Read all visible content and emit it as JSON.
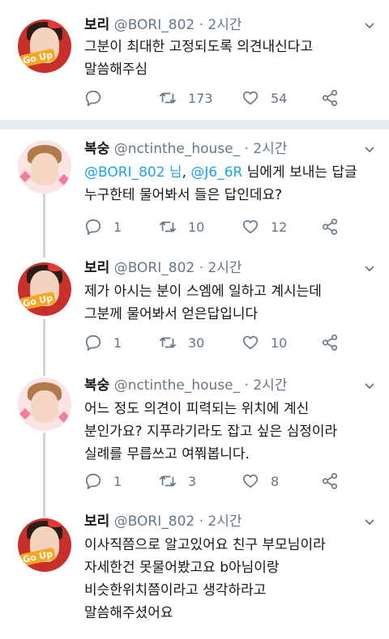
{
  "tweets": [
    {
      "name": "보리",
      "handle": "@BORI_802",
      "dot": "·",
      "time": "2시간",
      "lines": [
        "그분이 최대한 고정되도록 의견내신다고",
        "말씀해주심"
      ],
      "replies": "",
      "retweets": "173",
      "likes": "54"
    },
    {
      "name": "복숭",
      "handle": "@nctinthe_house_",
      "dot": "·",
      "time": "2시간",
      "reply_to_a": "@BORI_802 님",
      "reply_sep": ", ",
      "reply_to_b": "@J6_6R",
      "reply_suffix": " 님에게 보내는 답글",
      "lines": [
        "누구한테 물어봐서 들은 답인데요?"
      ],
      "replies": "1",
      "retweets": "10",
      "likes": "12"
    },
    {
      "name": "보리",
      "handle": "@BORI_802",
      "dot": "·",
      "time": "2시간",
      "lines": [
        "제가 아시는 분이 스엠에 일하고 계시는데",
        "그분께 물어봐서 얻은답입니다"
      ],
      "replies": "1",
      "retweets": "30",
      "likes": "10"
    },
    {
      "name": "복숭",
      "handle": "@nctinthe_house_",
      "dot": "·",
      "time": "2시간",
      "lines": [
        "어느 정도 의견이 피력되는 위치에 계신",
        "분인가요? 지푸라기라도 잡고 싶은 심정이라",
        "실례를 무릅쓰고 여쭤봅니다."
      ],
      "replies": "1",
      "retweets": "3",
      "likes": "8"
    },
    {
      "name": "보리",
      "handle": "@BORI_802",
      "dot": "·",
      "time": "2시간",
      "lines": [
        "이사직쯤으로 알고있어요 친구 부모님이라",
        "자세한건 못물어봤고요 b아님이랑",
        "비슷한위치쯤이라고 생각하라고",
        "말씀해주셨어요"
      ]
    }
  ],
  "colors": {
    "link": "#1da1f2",
    "secondary": "#657786",
    "divider": "#e6ecf0"
  },
  "icons": [
    "reply-icon",
    "retweet-icon",
    "like-icon",
    "share-icon",
    "chevron-down-icon"
  ]
}
